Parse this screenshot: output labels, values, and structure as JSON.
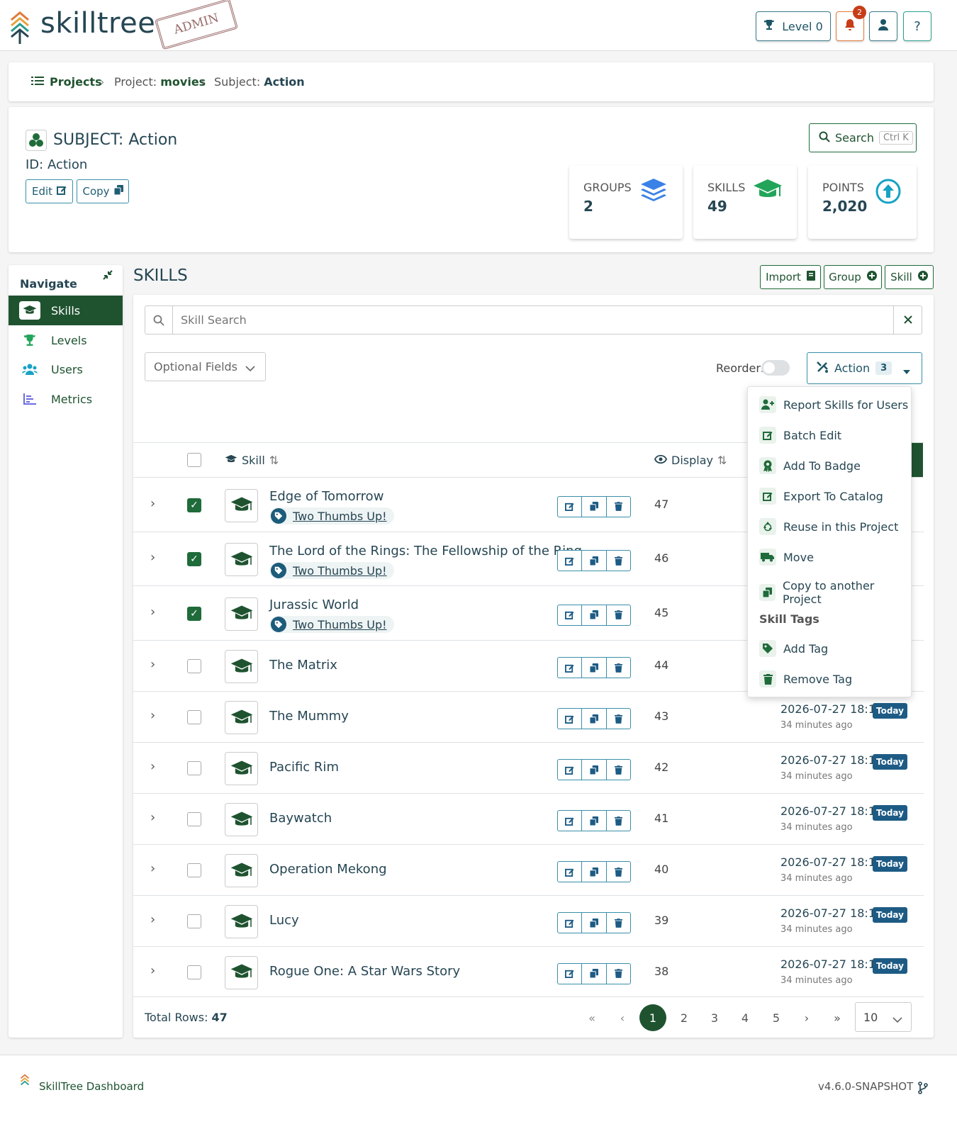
{
  "header": {
    "logo_text": "skilltree",
    "admin_stamp": "ADMIN",
    "level_label": "Level 0",
    "notification_count": "2",
    "help_label": "?"
  },
  "breadcrumb": {
    "projects": "Projects",
    "project_prefix": "Project:",
    "project_name": "movies",
    "subject_prefix": "Subject:",
    "subject_name": "Action"
  },
  "subject": {
    "title": "SUBJECT: Action",
    "id_line": "ID: Action",
    "edit_label": "Edit",
    "copy_label": "Copy",
    "search_label": "Search",
    "search_shortcut": "Ctrl K",
    "stats": [
      {
        "label": "GROUPS",
        "value": "2"
      },
      {
        "label": "SKILLS",
        "value": "49"
      },
      {
        "label": "POINTS",
        "value": "2,020"
      }
    ]
  },
  "nav": {
    "title": "Navigate",
    "items": [
      {
        "label": "Skills"
      },
      {
        "label": "Levels"
      },
      {
        "label": "Users"
      },
      {
        "label": "Metrics"
      }
    ]
  },
  "skills": {
    "heading": "SKILLS",
    "import_label": "Import",
    "group_label": "Group",
    "skill_label": "Skill",
    "search_placeholder": "Skill Search",
    "optional_fields": "Optional Fields",
    "reorder_label": "Reorder:",
    "action_label": "Action",
    "action_count": "3",
    "col_skill": "Skill",
    "col_display": "Display",
    "rows": [
      {
        "name": "Edge of Tomorrow",
        "tag": "Two Thumbs Up!",
        "checked": true,
        "display": "47"
      },
      {
        "name": "The Lord of the Rings: The Fellowship of the Ring",
        "tag": "Two Thumbs Up!",
        "checked": true,
        "display": "46"
      },
      {
        "name": "Jurassic World",
        "tag": "Two Thumbs Up!",
        "checked": true,
        "display": "45"
      },
      {
        "name": "The Matrix",
        "checked": false,
        "display": "44"
      },
      {
        "name": "The Mummy",
        "checked": false,
        "display": "43",
        "date": "2026-07-27 18:15",
        "ago": "34 minutes ago",
        "badge": "Today"
      },
      {
        "name": "Pacific Rim",
        "checked": false,
        "display": "42",
        "date": "2026-07-27 18:15",
        "ago": "34 minutes ago",
        "badge": "Today"
      },
      {
        "name": "Baywatch",
        "checked": false,
        "display": "41",
        "date": "2026-07-27 18:15",
        "ago": "34 minutes ago",
        "badge": "Today"
      },
      {
        "name": "Operation Mekong",
        "checked": false,
        "display": "40",
        "date": "2026-07-27 18:15",
        "ago": "34 minutes ago",
        "badge": "Today"
      },
      {
        "name": "Lucy",
        "checked": false,
        "display": "39",
        "date": "2026-07-27 18:15",
        "ago": "34 minutes ago",
        "badge": "Today"
      },
      {
        "name": "Rogue One: A Star Wars Story",
        "checked": false,
        "display": "38",
        "date": "2026-07-27 18:15",
        "ago": "34 minutes ago",
        "badge": "Today"
      }
    ],
    "total_rows_label": "Total Rows:",
    "total_rows_value": "47",
    "pages": [
      "1",
      "2",
      "3",
      "4",
      "5"
    ],
    "page_size": "10"
  },
  "action_menu": {
    "items": [
      {
        "label": "Report Skills for Users",
        "icon": "user-plus-icon"
      },
      {
        "label": "Batch Edit",
        "icon": "edit-icon"
      },
      {
        "label": "Add To Badge",
        "icon": "award-icon"
      },
      {
        "label": "Export To Catalog",
        "icon": "edit-icon"
      },
      {
        "label": "Reuse in this Project",
        "icon": "recycle-icon"
      },
      {
        "label": "Move",
        "icon": "truck-icon"
      },
      {
        "label": "Copy to another Project",
        "icon": "copy-icon"
      }
    ],
    "section_title": "Skill Tags",
    "tag_items": [
      {
        "label": "Add Tag",
        "icon": "tag-icon"
      },
      {
        "label": "Remove Tag",
        "icon": "trash-icon"
      }
    ]
  },
  "footer": {
    "dashboard_label": "SkillTree Dashboard",
    "version": "v4.6.0-SNAPSHOT"
  },
  "colors": {
    "brand_green": "#1f5330",
    "accent_teal": "#1d5b85",
    "header_text": "#264653"
  }
}
